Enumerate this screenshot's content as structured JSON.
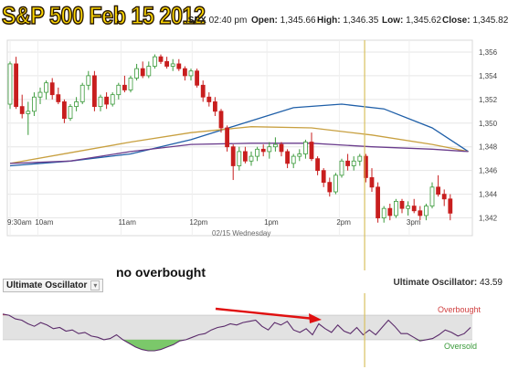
{
  "overlay_title": "S&P 500 Feb 15 2012",
  "quote": {
    "symbol": ".SPX",
    "time": "02:40 pm",
    "open_label": "Open:",
    "open": "1,345.66",
    "high_label": "High:",
    "high": "1,346.35",
    "low_label": "Low:",
    "low": "1,345.62",
    "close_label": "Close:",
    "close": "1,345.82"
  },
  "colors": {
    "up": "#3a9a3a",
    "down": "#c81e1e",
    "ma_blue": "#1f5fa8",
    "ma_gold": "#c8a040",
    "ma_purple": "#6a3c8c",
    "marker": "#d8c060",
    "oscillator": "#5a2a6a",
    "overbought": "#d04040",
    "oversold": "#3a9a3a",
    "arrow": "#e01010"
  },
  "chart_data": [
    {
      "type": "candlestick",
      "title": "",
      "x_tick_labels": [
        "9:30am",
        "10am",
        "11am",
        "12pm",
        "1pm",
        "2pm",
        "3pm"
      ],
      "x_sublabel": "02/15 Wednesday",
      "y_tick_labels": [
        "1,356",
        "1,354",
        "1,352",
        "1,350",
        "1,348",
        "1,346",
        "1,344",
        "1,342"
      ],
      "ylim": [
        1340.5,
        1357
      ],
      "grid": true,
      "marker_time": "2:40pm",
      "candles": [
        [
          1351.6,
          1355.2,
          1351.2,
          1355.0
        ],
        [
          1355.0,
          1355.6,
          1351.2,
          1351.4
        ],
        [
          1351.4,
          1352.4,
          1350.4,
          1350.8
        ],
        [
          1350.8,
          1351.8,
          1349.0,
          1351.0
        ],
        [
          1351.0,
          1352.6,
          1350.6,
          1352.2
        ],
        [
          1352.2,
          1353.0,
          1351.6,
          1352.6
        ],
        [
          1352.6,
          1353.6,
          1352.0,
          1353.4
        ],
        [
          1353.4,
          1353.8,
          1352.0,
          1352.4
        ],
        [
          1352.4,
          1353.0,
          1351.6,
          1351.8
        ],
        [
          1351.8,
          1352.0,
          1350.0,
          1350.4
        ],
        [
          1350.4,
          1351.6,
          1350.2,
          1351.4
        ],
        [
          1351.4,
          1352.2,
          1351.0,
          1351.8
        ],
        [
          1351.8,
          1353.4,
          1351.6,
          1353.2
        ],
        [
          1353.2,
          1354.4,
          1352.8,
          1354.0
        ],
        [
          1354.0,
          1354.4,
          1351.0,
          1351.4
        ],
        [
          1351.4,
          1352.4,
          1351.0,
          1352.2
        ],
        [
          1352.2,
          1352.6,
          1351.2,
          1351.6
        ],
        [
          1351.6,
          1352.6,
          1351.4,
          1352.4
        ],
        [
          1352.4,
          1353.4,
          1352.0,
          1353.2
        ],
        [
          1353.2,
          1354.0,
          1352.6,
          1352.8
        ],
        [
          1352.8,
          1354.0,
          1352.6,
          1353.8
        ],
        [
          1353.8,
          1355.0,
          1353.6,
          1354.6
        ],
        [
          1354.6,
          1355.2,
          1353.8,
          1354.0
        ],
        [
          1354.0,
          1355.2,
          1353.8,
          1354.8
        ],
        [
          1354.8,
          1355.8,
          1354.6,
          1355.6
        ],
        [
          1355.6,
          1355.8,
          1355.0,
          1355.2
        ],
        [
          1355.2,
          1355.6,
          1354.6,
          1354.8
        ],
        [
          1354.8,
          1355.4,
          1354.4,
          1355.0
        ],
        [
          1355.0,
          1355.4,
          1354.4,
          1354.6
        ],
        [
          1354.6,
          1354.8,
          1353.6,
          1354.0
        ],
        [
          1354.0,
          1354.6,
          1353.6,
          1354.4
        ],
        [
          1354.4,
          1354.6,
          1353.0,
          1353.2
        ],
        [
          1353.2,
          1353.6,
          1351.8,
          1352.2
        ],
        [
          1352.2,
          1352.6,
          1351.4,
          1351.8
        ],
        [
          1351.8,
          1352.2,
          1350.6,
          1351.0
        ],
        [
          1351.0,
          1351.2,
          1349.2,
          1349.6
        ],
        [
          1349.6,
          1349.8,
          1347.6,
          1348.0
        ],
        [
          1348.0,
          1348.2,
          1345.2,
          1346.4
        ],
        [
          1346.4,
          1348.0,
          1346.0,
          1347.6
        ],
        [
          1347.6,
          1348.0,
          1346.6,
          1346.8
        ],
        [
          1346.8,
          1347.6,
          1346.4,
          1347.2
        ],
        [
          1347.2,
          1348.0,
          1346.8,
          1347.8
        ],
        [
          1347.8,
          1348.2,
          1347.2,
          1347.6
        ],
        [
          1347.6,
          1348.4,
          1347.0,
          1348.0
        ],
        [
          1348.0,
          1348.8,
          1347.6,
          1348.2
        ],
        [
          1348.2,
          1348.4,
          1347.2,
          1347.6
        ],
        [
          1347.6,
          1347.8,
          1346.2,
          1346.6
        ],
        [
          1346.6,
          1347.4,
          1346.2,
          1347.2
        ],
        [
          1347.2,
          1347.8,
          1346.8,
          1347.4
        ],
        [
          1347.4,
          1348.6,
          1347.0,
          1348.4
        ],
        [
          1348.4,
          1349.2,
          1346.8,
          1347.0
        ],
        [
          1347.0,
          1347.2,
          1345.6,
          1346.0
        ],
        [
          1346.0,
          1346.2,
          1344.6,
          1345.0
        ],
        [
          1345.0,
          1345.4,
          1343.8,
          1344.2
        ],
        [
          1344.2,
          1345.8,
          1344.0,
          1345.6
        ],
        [
          1345.6,
          1347.0,
          1345.4,
          1346.8
        ],
        [
          1346.8,
          1347.4,
          1346.0,
          1346.4
        ],
        [
          1346.4,
          1347.2,
          1346.0,
          1346.8
        ],
        [
          1346.8,
          1347.4,
          1346.4,
          1347.2
        ],
        [
          1347.2,
          1347.4,
          1345.0,
          1345.4
        ],
        [
          1345.4,
          1346.2,
          1344.2,
          1344.6
        ],
        [
          1344.6,
          1345.0,
          1341.6,
          1342.0
        ],
        [
          1342.0,
          1343.0,
          1341.6,
          1342.8
        ],
        [
          1342.8,
          1343.2,
          1341.8,
          1342.2
        ],
        [
          1342.2,
          1343.6,
          1342.0,
          1343.4
        ],
        [
          1343.4,
          1343.6,
          1342.4,
          1342.8
        ],
        [
          1342.8,
          1343.4,
          1342.2,
          1343.0
        ],
        [
          1343.0,
          1343.6,
          1342.4,
          1342.6
        ],
        [
          1342.6,
          1343.0,
          1341.8,
          1342.2
        ],
        [
          1342.2,
          1343.2,
          1341.8,
          1343.0
        ],
        [
          1343.0,
          1345.0,
          1342.8,
          1344.6
        ],
        [
          1344.6,
          1345.6,
          1343.8,
          1344.0
        ],
        [
          1344.0,
          1344.4,
          1343.0,
          1343.6
        ],
        [
          1343.6,
          1344.0,
          1341.8,
          1342.4
        ]
      ],
      "moving_averages": [
        {
          "color_key": "ma_blue",
          "points": [
            [
              0,
              1346.4
            ],
            [
              10,
              1346.8
            ],
            [
              20,
              1347.4
            ],
            [
              30,
              1348.6
            ],
            [
              40,
              1350.2
            ],
            [
              47,
              1351.3
            ],
            [
              55,
              1351.6
            ],
            [
              62,
              1351.2
            ],
            [
              70,
              1349.6
            ],
            [
              76,
              1347.6
            ]
          ]
        },
        {
          "color_key": "ma_gold",
          "points": [
            [
              0,
              1346.6
            ],
            [
              10,
              1347.5
            ],
            [
              20,
              1348.4
            ],
            [
              30,
              1349.2
            ],
            [
              40,
              1349.7
            ],
            [
              50,
              1349.6
            ],
            [
              60,
              1349.0
            ],
            [
              70,
              1348.2
            ],
            [
              76,
              1347.6
            ]
          ]
        },
        {
          "color_key": "ma_purple",
          "points": [
            [
              0,
              1346.6
            ],
            [
              10,
              1346.8
            ],
            [
              20,
              1347.6
            ],
            [
              30,
              1348.2
            ],
            [
              40,
              1348.3
            ],
            [
              50,
              1348.3
            ],
            [
              60,
              1348.0
            ],
            [
              70,
              1347.8
            ],
            [
              76,
              1347.6
            ]
          ]
        }
      ]
    },
    {
      "type": "line",
      "title": "Ultimate Oscillator",
      "value_label": "Ultimate Oscillator:",
      "value": "43.59",
      "overbought_label": "Overbought",
      "oversold_label": "Oversold",
      "ylim": [
        0,
        100
      ],
      "overbought_level": 70,
      "oversold_level": 30,
      "values": [
        72,
        70,
        64,
        62,
        56,
        52,
        58,
        54,
        48,
        50,
        44,
        46,
        40,
        42,
        36,
        34,
        30,
        32,
        38,
        30,
        24,
        18,
        14,
        12,
        12,
        14,
        18,
        22,
        28,
        30,
        34,
        38,
        40,
        46,
        50,
        52,
        56,
        54,
        58,
        60,
        62,
        52,
        46,
        58,
        54,
        60,
        46,
        42,
        48,
        38,
        56,
        48,
        42,
        54,
        44,
        40,
        50,
        38,
        46,
        38,
        50,
        62,
        52,
        40,
        40,
        34,
        28,
        30,
        32,
        38,
        46,
        42,
        36,
        40,
        50
      ]
    }
  ],
  "annotation": {
    "text": "no overbought"
  }
}
